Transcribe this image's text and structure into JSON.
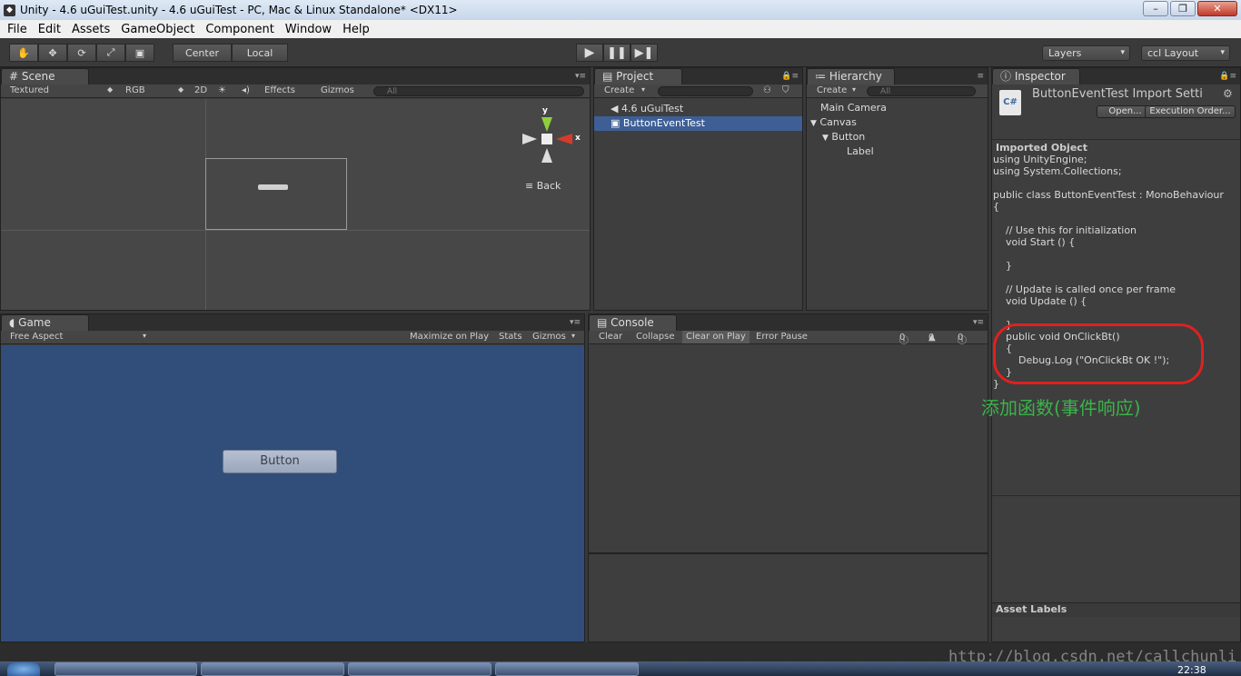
{
  "window": {
    "title": "Unity - 4.6 uGuiTest.unity - 4.6 uGuiTest - PC, Mac & Linux Standalone* <DX11>"
  },
  "menu": [
    "File",
    "Edit",
    "Assets",
    "GameObject",
    "Component",
    "Window",
    "Help"
  ],
  "toolbar": {
    "center": "Center",
    "local": "Local",
    "layers": "Layers",
    "layout": "ccl Layout"
  },
  "scene": {
    "tab": "Scene",
    "shading": "Textured",
    "rgb": "RGB",
    "mode2d": "2D",
    "effects": "Effects",
    "gizmos": "Gizmos",
    "search": "All",
    "view_label": "Back",
    "gizmo_y": "y",
    "gizmo_x": "x"
  },
  "game": {
    "tab": "Game",
    "aspect": "Free Aspect",
    "maximize": "Maximize on Play",
    "stats": "Stats",
    "gizmos": "Gizmos",
    "button_label": "Button"
  },
  "project": {
    "tab": "Project",
    "create": "Create",
    "items": [
      "4.6 uGuiTest",
      "ButtonEventTest"
    ]
  },
  "hierarchy": {
    "tab": "Hierarchy",
    "create": "Create",
    "search": "All",
    "items": [
      "Main Camera",
      "Canvas",
      "Button",
      "Label"
    ]
  },
  "console": {
    "tab": "Console",
    "clear": "Clear",
    "collapse": "Collapse",
    "clear_on_play": "Clear on Play",
    "error_pause": "Error Pause",
    "count_info": "0",
    "count_warn": "0",
    "count_error": "0"
  },
  "inspector": {
    "tab": "Inspector",
    "title": "ButtonEventTest Import Setti",
    "open": "Open...",
    "execution_order": "Execution Order...",
    "section": "Imported Object",
    "code": [
      "using UnityEngine;",
      "using System.Collections;",
      "",
      "public class ButtonEventTest : MonoBehaviour",
      "{",
      "",
      "    // Use this for initialization",
      "    void Start () {",
      "",
      "    }",
      "",
      "    // Update is called once per frame",
      "    void Update () {",
      "",
      "    }",
      "    public void OnClickBt()",
      "    {",
      "        Debug.Log (\"OnClickBt OK !\");",
      "    }",
      "}"
    ],
    "annotation": "添加函数(事件响应)",
    "asset_labels": "Asset Labels"
  },
  "watermark": "http://blog.csdn.net/callchunli",
  "taskbar": {
    "clock": "22:38"
  },
  "colors": {
    "accent": "#3e5f96",
    "game_bg": "#314d7a",
    "annotation": "#3bb34a",
    "highlight_ring": "#e02020"
  }
}
